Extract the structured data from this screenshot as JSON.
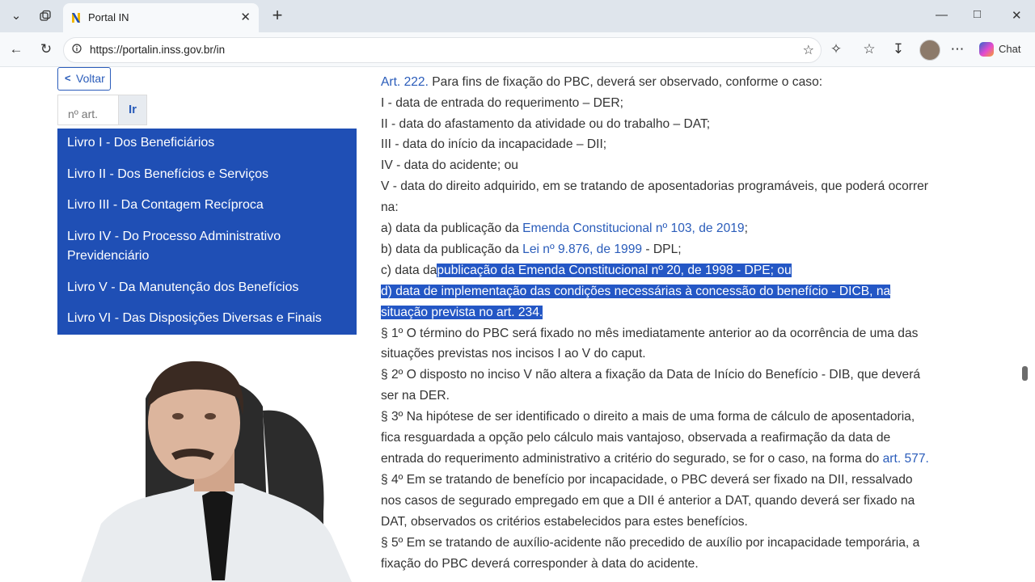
{
  "browser": {
    "tab_title": "Portal IN",
    "url": "https://portalin.inss.gov.br/in",
    "chat_label": "Chat"
  },
  "sidebar": {
    "back_label": "Voltar",
    "article_placeholder": "nº art.",
    "go_label": "Ir",
    "books": [
      {
        "label": "Livro I - Dos Beneficiários"
      },
      {
        "label": "Livro II - Dos Benefícios e Serviços"
      },
      {
        "label": "Livro III - Da Contagem Recíproca"
      },
      {
        "label": "Livro IV - Do Processo Administrativo Previdenciário"
      },
      {
        "label": "Livro V - Da Manutenção dos Benefícios"
      },
      {
        "label": "Livro VI - Das Disposições Diversas e Finais"
      }
    ]
  },
  "law": {
    "art_link": "Art. 222.",
    "art_text": " Para fins de fixação do PBC, deverá ser observado, conforme o caso:",
    "item_i": "I - data de entrada do requerimento – DER;",
    "item_ii": "II - data do afastamento da atividade ou do trabalho – DAT;",
    "item_iii": "III - data do início da incapacidade – DII;",
    "item_iv": "IV - data do acidente; ou",
    "item_v_1": "V - data do direito adquirido, em se tratando de aposentadorias programáveis, que poderá ocorrer",
    "item_v_2": "na:",
    "a_pre": "a) data da publicação da ",
    "a_link": "Emenda Constitucional nº 103, de 2019",
    "a_post": ";",
    "b_pre": "b) data da publicação da ",
    "b_link": "Lei nº 9.876, de 1999",
    "b_post": " - DPL;",
    "c_pre": "c) data da",
    "c_sel": "publicação da Emenda Constitucional nº 20, de 1998 - DPE; ou",
    "d_1": "d) data de implementação das condições necessárias à concessão do benefício - DICB, na",
    "d_2": "situação prevista no art. 234.",
    "p1_1": "§ 1º O término do PBC será fixado no mês imediatamente anterior ao da ocorrência de uma das",
    "p1_2": "situações previstas nos incisos I ao V do caput.",
    "p2_1": "§ 2º O disposto no inciso V não altera a fixação da Data de Início do Benefício - DIB, que deverá",
    "p2_2": "ser na DER.",
    "p3_1": "§ 3º Na hipótese de ser identificado o direito a mais de uma forma de cálculo de aposentadoria,",
    "p3_2": "fica resguardada a opção pelo cálculo mais vantajoso, observada a reafirmação da data de",
    "p3_3_pre": "entrada do requerimento administrativo a critério do segurado, se for o caso, na forma do ",
    "p3_3_link": "art. 577",
    "p3_3_post": ".",
    "p4_1": "§ 4º Em se tratando de benefício por incapacidade, o PBC deverá ser fixado na DII, ressalvado",
    "p4_2": "nos casos de segurado empregado em que a DII é anterior a DAT, quando deverá ser fixado na",
    "p4_3": "DAT, observados os critérios estabelecidos para estes benefícios.",
    "p5_1": "§ 5º Em se tratando de auxílio-acidente não precedido de auxílio por incapacidade temporária, a",
    "p5_2": "fixação do PBC deverá corresponder à data do acidente."
  }
}
